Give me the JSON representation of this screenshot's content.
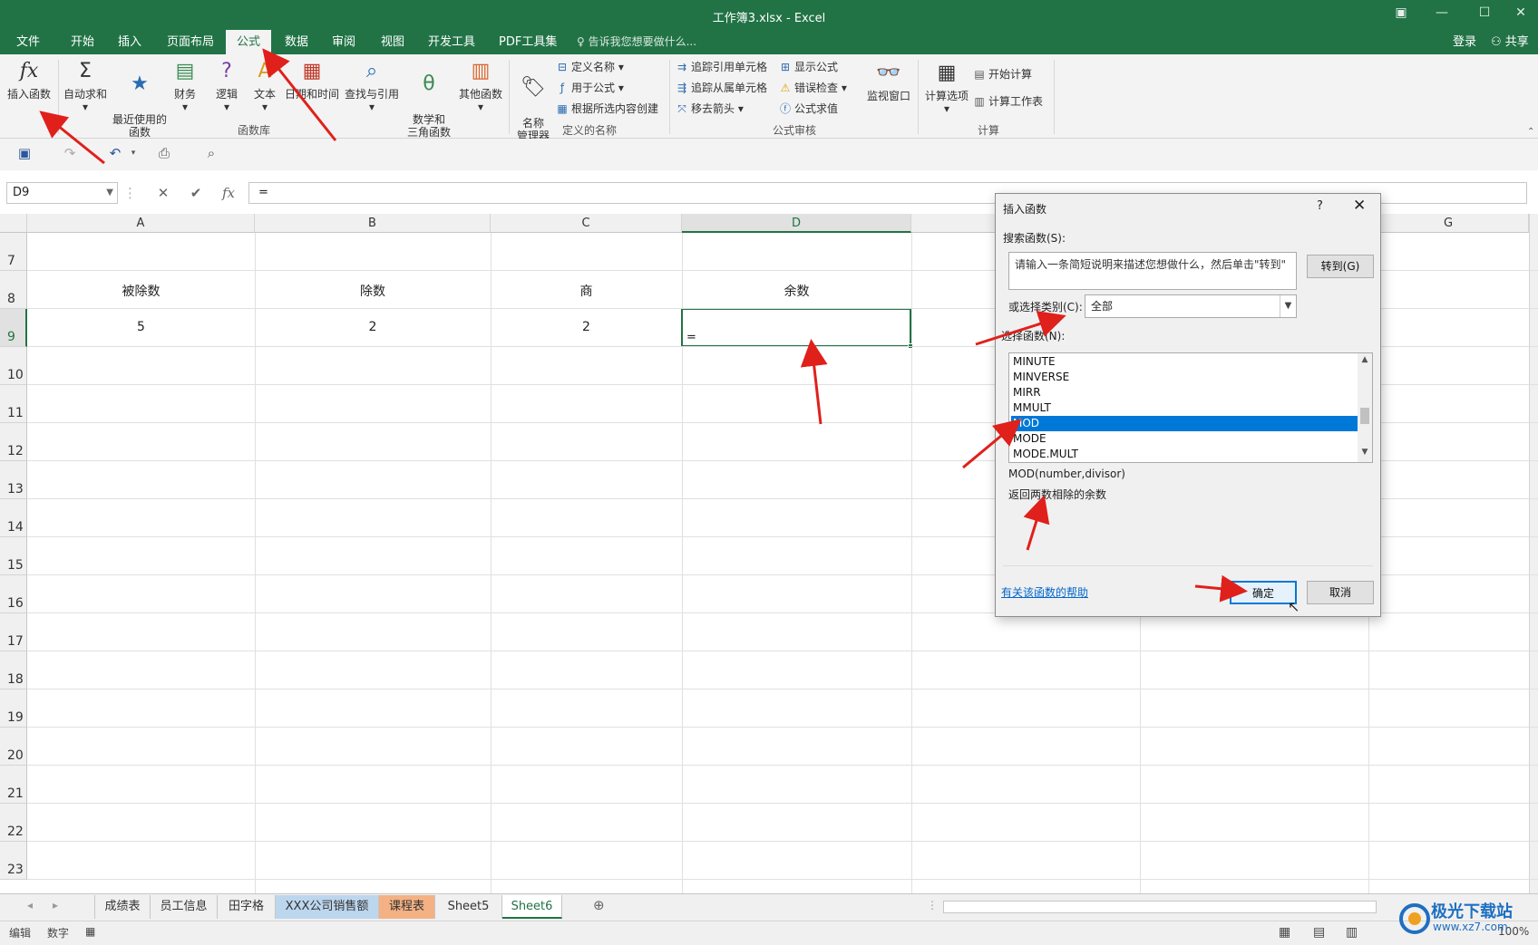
{
  "window": {
    "title": "工作簿3.xlsx - Excel"
  },
  "ribbon_tabs": [
    "文件",
    "开始",
    "插入",
    "页面布局",
    "公式",
    "数据",
    "审阅",
    "视图",
    "开发工具",
    "PDF工具集"
  ],
  "active_tab": "公式",
  "tell_me": "告诉我您想要做什么...",
  "account": {
    "login": "登录",
    "share": "共享"
  },
  "ribbon": {
    "function_library": {
      "group_label": "函数库",
      "buttons": [
        "插入函数",
        "自动求和",
        "最近使用的\n函数",
        "财务",
        "逻辑",
        "文本",
        "日期和时间",
        "查找与引用",
        "数学和\n三角函数",
        "其他函数"
      ]
    },
    "defined_names": {
      "group_label": "定义的名称",
      "big": "名称\n管理器",
      "small": [
        "定义名称",
        "用于公式",
        "根据所选内容创建"
      ]
    },
    "formula_auditing": {
      "group_label": "公式审核",
      "small": [
        "追踪引用单元格",
        "追踪从属单元格",
        "移去箭头",
        "显示公式",
        "错误检查",
        "公式求值"
      ],
      "big": "监视窗口"
    },
    "calculation": {
      "group_label": "计算",
      "big": "计算选项",
      "small": [
        "开始计算",
        "计算工作表"
      ]
    }
  },
  "formula_bar": {
    "name_box": "D9",
    "formula": "="
  },
  "columns": [
    "A",
    "B",
    "C",
    "D",
    "E",
    "F",
    "G"
  ],
  "rows": [
    "7",
    "8",
    "9",
    "10",
    "11",
    "12",
    "13",
    "14",
    "15",
    "16",
    "17",
    "18",
    "19",
    "20",
    "21",
    "22",
    "23"
  ],
  "cells": {
    "A8": "被除数",
    "B8": "除数",
    "C8": "商",
    "D8": "余数",
    "A9": "5",
    "B9": "2",
    "C9": "2",
    "D9": "="
  },
  "sheet_tabs": [
    "成绩表",
    "员工信息",
    "田字格",
    "XXX公司销售额",
    "课程表",
    "Sheet5",
    "Sheet6"
  ],
  "active_sheet": "Sheet6",
  "status": {
    "mode": "编辑",
    "numlock": "数字",
    "zoom": "100%"
  },
  "dialog": {
    "title": "插入函数",
    "help_q": "?",
    "search_label": "搜索函数(S):",
    "search_text": "请输入一条简短说明来描述您想做什么，然后单击\"转到\"",
    "goto_button": "转到(G)",
    "category_label": "或选择类别(C):",
    "category_value": "全部",
    "select_label": "选择函数(N):",
    "functions": [
      "MINUTE",
      "MINVERSE",
      "MIRR",
      "MMULT",
      "MOD",
      "MODE",
      "MODE.MULT"
    ],
    "selected_function": "MOD",
    "signature": "MOD(number,divisor)",
    "description": "返回两数相除的余数",
    "help_link": "有关该函数的帮助",
    "ok": "确定",
    "cancel": "取消"
  },
  "watermark": {
    "title": "极光下载站",
    "url": "www.xz7.com"
  }
}
